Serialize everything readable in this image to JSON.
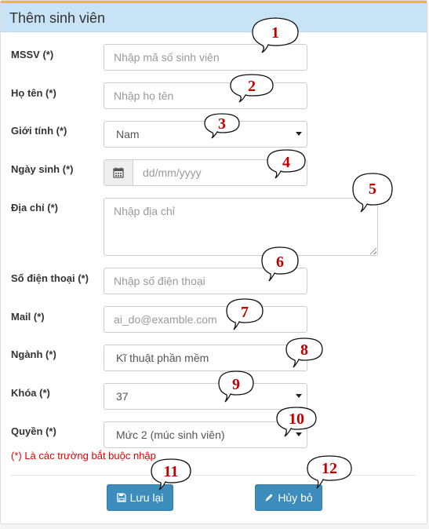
{
  "header": {
    "title": "Thêm sinh viên"
  },
  "form": {
    "mssv": {
      "label": "MSSV (*)",
      "placeholder": "Nhập mã số sinh viên",
      "value": ""
    },
    "ho_ten": {
      "label": "Họ tên (*)",
      "placeholder": "Nhập họ tên",
      "value": ""
    },
    "gioi_tinh": {
      "label": "Giới tính (*)",
      "selected": "Nam"
    },
    "ngay_sinh": {
      "label": "Ngày sinh (*)",
      "placeholder": "dd/mm/yyyy",
      "icon": "calendar-icon"
    },
    "dia_chi": {
      "label": "Địa chỉ (*)",
      "placeholder": "Nhập địa chỉ"
    },
    "so_dien_thoai": {
      "label": "Số điện thoại (*)",
      "placeholder": "Nhập số điện thoại"
    },
    "mail": {
      "label": "Mail (*)",
      "placeholder": "ai_do@examble.com"
    },
    "nganh": {
      "label": "Ngành (*)",
      "selected": "Kĩ thuật phần mềm"
    },
    "khoa": {
      "label": "Khóa (*)",
      "selected": "37"
    },
    "quyen": {
      "label": "Quyền (*)",
      "selected": "Mức 2 (múc sinh viên)"
    },
    "required_note": "(*) Là các trường bắt buộc nhập"
  },
  "buttons": {
    "save": {
      "label": "Lưu lại",
      "icon": "save-icon"
    },
    "cancel": {
      "label": "Hủy bỏ",
      "icon": "pencil-icon"
    }
  },
  "callouts": [
    "1",
    "2",
    "3",
    "4",
    "5",
    "6",
    "7",
    "8",
    "9",
    "10",
    "11",
    "12"
  ],
  "colors": {
    "header_bg": "#c7e3f5",
    "header_accent": "#e8b93c",
    "button": "#3c8dbc",
    "required_text": "#e60000",
    "callout_number": "#c00000"
  }
}
